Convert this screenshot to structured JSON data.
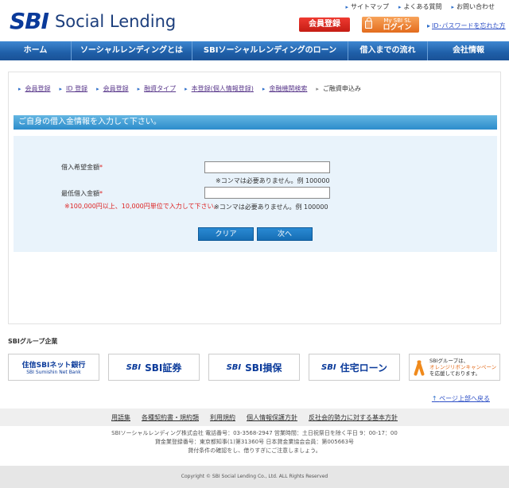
{
  "header": {
    "logo_mark": "SBI",
    "logo_text": "Social Lending",
    "util_links": [
      "サイトマップ",
      "よくある質問",
      "お問い合わせ"
    ],
    "register_label": "会員登録",
    "login_line1": "My SBI SL",
    "login_line2": "ログイン",
    "forgot_label": "ID･パスワードを忘れた方"
  },
  "nav": {
    "items": [
      "ホーム",
      "ソーシャルレンディングとは",
      "SBIソーシャルレンディングのローン",
      "借入までの流れ",
      "会社情報"
    ]
  },
  "breadcrumb": [
    "会員登録",
    "ID 登録",
    "会員登録",
    "融資タイプ",
    "本登録(個人情報登録)",
    "金融機関検索",
    "ご融資申込み"
  ],
  "form": {
    "section_title": "ご自身の借入金情報を入力して下さい。",
    "desired_label": "借入希望金額",
    "desired_value": "",
    "desired_hint": "※コンマは必要ありません。例 100000",
    "min_label": "最低借入金額",
    "min_value": "",
    "min_warning": "※100,000円以上、10,000円単位で入力して下さい。",
    "min_hint": "※コンマは必要ありません。例 100000",
    "required_mark": "*",
    "clear_label": "クリア",
    "next_label": "次へ"
  },
  "group": {
    "title": "SBIグループ企業",
    "netbank_line1": "住信SBIネット銀行",
    "netbank_line2": "SBI Sumishin Net Bank",
    "securities": "SBI証券",
    "insurance": "SBI損保",
    "housing": "住宅ローン",
    "sbi_mark": "SBI",
    "ribbon_line1": "SBIグループは、",
    "ribbon_line2": "オレンジリボンキャンペーン",
    "ribbon_line3": "を応援しております。"
  },
  "page_top": "ページ上部へ戻る",
  "footer": {
    "links": [
      "用語集",
      "各種契約書・規約類",
      "利用規約",
      "個人情報保護方針",
      "反社会的勢力に対する基本方針"
    ],
    "info_line1": "SBIソーシャルレンディング株式会社  電話番号：03-3568-2947  営業時間：土日祝祭日を除く平日 9：00-17：00",
    "info_line2": "貸金業登録番号：東京都知事(1)第31360号  日本貸金業協会会員：第005663号",
    "info_line3": "貸付条件の確認をし、借りすぎにご注意しましょう。",
    "copyright": "Copyright © SBI Social Lending Co., Ltd. ALL Rights Reserved"
  }
}
